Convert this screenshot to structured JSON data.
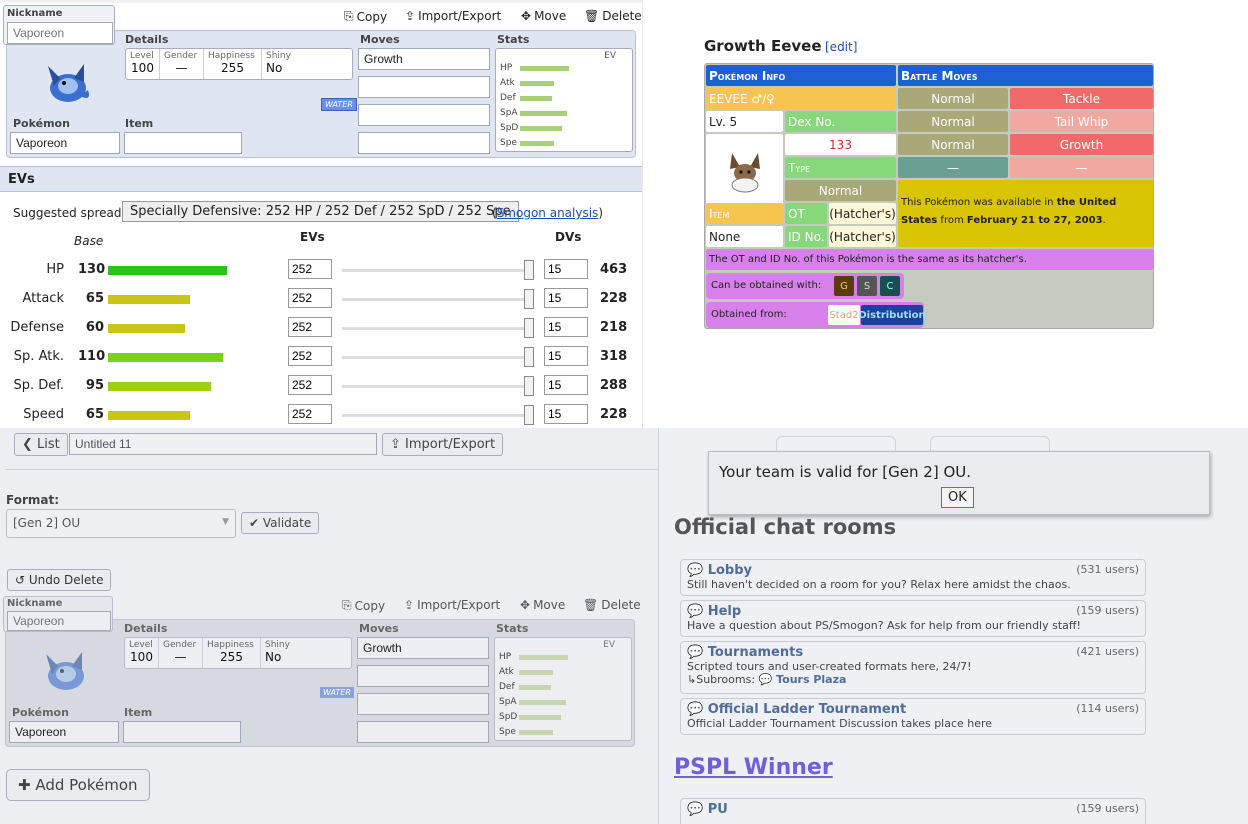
{
  "builder": {
    "toolbar": {
      "copy": "Copy",
      "import_export": "Import/Export",
      "move": "Move",
      "delete": "Delete"
    },
    "nickname_label": "Nickname",
    "nickname_placeholder": "Vaporeon",
    "details_label": "Details",
    "details": [
      {
        "h": "Level",
        "v": "100"
      },
      {
        "h": "Gender",
        "v": "—"
      },
      {
        "h": "Happiness",
        "v": "255"
      },
      {
        "h": "Shiny",
        "v": "No"
      }
    ],
    "type_badge": "WATER",
    "pokemon_label": "Pokémon",
    "pokemon_value": "Vaporeon",
    "item_label": "Item",
    "item_value": "",
    "moves_label": "Moves",
    "moves": [
      "Growth",
      "",
      "",
      ""
    ],
    "stats_label": "Stats",
    "ev_label": "EV",
    "stats_short": [
      "HP",
      "Atk",
      "Def",
      "SpA",
      "SpD",
      "Spe"
    ],
    "stats_short_fill": [
      0.65,
      0.45,
      0.42,
      0.62,
      0.55,
      0.45
    ],
    "evs_header": "EVs",
    "suggested_label": "Suggested spread:",
    "suggested_value": "Specially Defensive: 252 HP / 252 Def / 252 SpD / 252 Spe",
    "smogon_link": "Smogon analysis",
    "col_base": "Base",
    "col_evs": "EVs",
    "col_dvs": "DVs",
    "rows": [
      {
        "name": "HP",
        "base": "130",
        "ev": "252",
        "dv": "15",
        "total": "463",
        "color": "#2fbf1f",
        "fill": 0.51
      },
      {
        "name": "Attack",
        "base": "65",
        "ev": "252",
        "dv": "15",
        "total": "228",
        "color": "#c9c514",
        "fill": 0.35
      },
      {
        "name": "Defense",
        "base": "60",
        "ev": "252",
        "dv": "15",
        "total": "218",
        "color": "#c9c514",
        "fill": 0.33
      },
      {
        "name": "Sp. Atk.",
        "base": "110",
        "ev": "252",
        "dv": "15",
        "total": "318",
        "color": "#7ad11a",
        "fill": 0.49
      },
      {
        "name": "Sp. Def.",
        "base": "95",
        "ev": "252",
        "dv": "15",
        "total": "288",
        "color": "#9fce16",
        "fill": 0.44
      },
      {
        "name": "Speed",
        "base": "65",
        "ev": "252",
        "dv": "15",
        "total": "228",
        "color": "#c9c514",
        "fill": 0.35
      }
    ]
  },
  "wiki": {
    "title": "Growth Eevee",
    "edit": "[edit]",
    "hdr_info": "Pokémon Info",
    "hdr_moves": "Battle Moves",
    "name": "EEVEE ♂/♀",
    "level": "Lv. 5",
    "dex_label": "Dex No.",
    "dex_value": "133",
    "type_label": "Type",
    "type_value": "Normal",
    "item_label": "Item",
    "item_value": "None",
    "ot_label": "OT",
    "ot_value": "(Hatcher's)",
    "id_label": "ID No.",
    "id_value": "(Hatcher's)",
    "moves": [
      {
        "type": "Normal",
        "move": "Tackle"
      },
      {
        "type": "Normal",
        "move": "Tail Whip"
      },
      {
        "type": "Normal",
        "move": "Growth"
      },
      {
        "type": "—",
        "move": "—"
      }
    ],
    "avail_pre": "This Pokémon was available in ",
    "avail_region": "the United States",
    "avail_mid": " from ",
    "avail_dates": "February 21 to 27, 2003",
    "avail_end": ".",
    "ot_note": "The OT and ID No. of this Pokémon is the same as its hatcher's.",
    "obtain_with": "Can be obtained with:",
    "games": [
      "G",
      "S",
      "C"
    ],
    "obtain_from": "Obtained from:",
    "from_a": "Stad2",
    "from_b": "Distribution"
  },
  "teambar": {
    "list_btn": "List",
    "team_name": "Untitled 11",
    "import_export": "Import/Export",
    "format_label": "Format:",
    "format_value": "[Gen 2] OU",
    "validate": "Validate",
    "undo_delete": "Undo Delete",
    "add_pokemon": "Add Pokémon"
  },
  "rooms": {
    "popup_text": "Your team is valid for [Gen 2] OU.",
    "ok": "OK",
    "official_title": "Official chat rooms",
    "list": [
      {
        "name": "Lobby",
        "users": "(531 users)",
        "desc": "Still haven't decided on a room for you? Relax here amidst the chaos."
      },
      {
        "name": "Help",
        "users": "(159 users)",
        "desc": "Have a question about PS/Smogon? Ask for help from our friendly staff!"
      },
      {
        "name": "Tournaments",
        "users": "(421 users)",
        "desc": "Scripted tours and user-created formats here, 24/7!",
        "sub_label": "↳Subrooms:",
        "sub": "Tours Plaza"
      },
      {
        "name": "Official Ladder Tournament",
        "users": "(114 users)",
        "desc": "Official Ladder Tournament Discussion takes place here"
      }
    ],
    "pspl_title": "PSPL Winner",
    "pspl_room": {
      "name": "PU",
      "users": "(159 users)"
    }
  }
}
